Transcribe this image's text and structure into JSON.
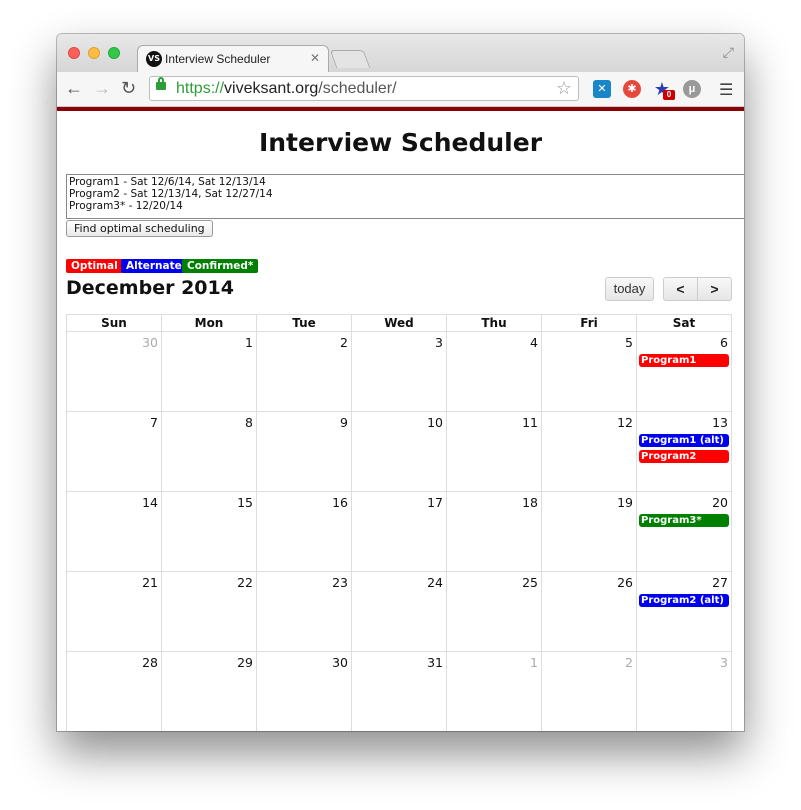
{
  "browser": {
    "tab_title": "Interview Scheduler",
    "tab_favicon_text": "VS",
    "url_scheme": "https://",
    "url_host": "viveksant.org",
    "url_path": "/scheduler/",
    "extension_badge": "0"
  },
  "page": {
    "title": "Interview Scheduler",
    "input_text": "Program1 - Sat 12/6/14, Sat 12/13/14\nProgram2 - Sat 12/13/14, Sat 12/27/14\nProgram3* - 12/20/14",
    "find_button": "Find optimal scheduling",
    "legend": [
      {
        "label": "Optimal",
        "color": "#ff0000"
      },
      {
        "label": "Alternate",
        "color": "#0000ee"
      },
      {
        "label": "Confirmed*",
        "color": "#008000"
      }
    ]
  },
  "calendar": {
    "title": "December 2014",
    "today_button": "today",
    "prev_icon": "‹",
    "next_icon": "›",
    "days_of_week": [
      "Sun",
      "Mon",
      "Tue",
      "Wed",
      "Thu",
      "Fri",
      "Sat"
    ],
    "weeks": [
      [
        {
          "n": "30",
          "other": true
        },
        {
          "n": "1"
        },
        {
          "n": "2"
        },
        {
          "n": "3"
        },
        {
          "n": "4"
        },
        {
          "n": "5"
        },
        {
          "n": "6",
          "events": [
            {
              "label": "Program1",
              "color": "#ff0000"
            }
          ]
        }
      ],
      [
        {
          "n": "7"
        },
        {
          "n": "8"
        },
        {
          "n": "9"
        },
        {
          "n": "10"
        },
        {
          "n": "11"
        },
        {
          "n": "12"
        },
        {
          "n": "13",
          "events": [
            {
              "label": "Program1 (alt)",
              "color": "#0000ee"
            },
            {
              "label": "Program2",
              "color": "#ff0000"
            }
          ]
        }
      ],
      [
        {
          "n": "14"
        },
        {
          "n": "15"
        },
        {
          "n": "16"
        },
        {
          "n": "17"
        },
        {
          "n": "18"
        },
        {
          "n": "19"
        },
        {
          "n": "20",
          "events": [
            {
              "label": "Program3*",
              "color": "#008000"
            }
          ]
        }
      ],
      [
        {
          "n": "21"
        },
        {
          "n": "22"
        },
        {
          "n": "23"
        },
        {
          "n": "24"
        },
        {
          "n": "25"
        },
        {
          "n": "26"
        },
        {
          "n": "27",
          "events": [
            {
              "label": "Program2 (alt)",
              "color": "#0000ee"
            }
          ]
        }
      ],
      [
        {
          "n": "28"
        },
        {
          "n": "29"
        },
        {
          "n": "30"
        },
        {
          "n": "31"
        },
        {
          "n": "1",
          "other": true
        },
        {
          "n": "2",
          "other": true
        },
        {
          "n": "3",
          "other": true
        }
      ]
    ]
  }
}
